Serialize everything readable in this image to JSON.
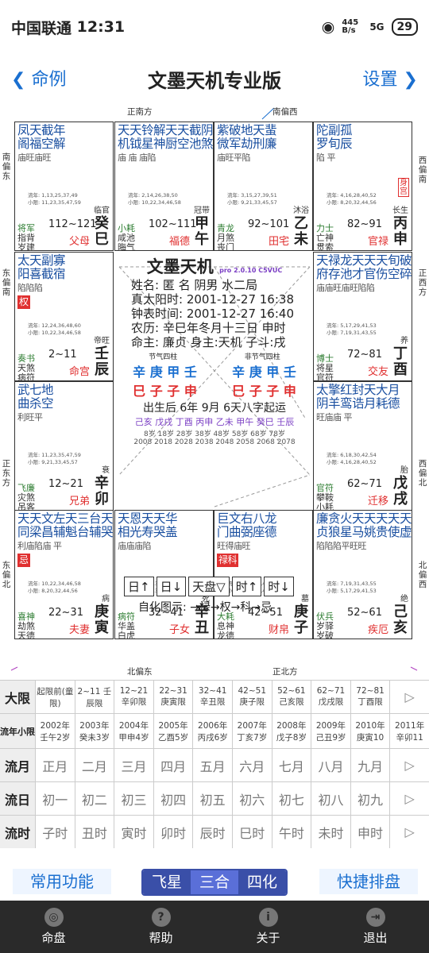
{
  "status": {
    "carrier": "中国联通",
    "time": "12:31",
    "net": "445 B/s",
    "sig": "5G",
    "battery": "29"
  },
  "nav": {
    "back": "命例",
    "title": "文墨天机专业版",
    "settings": "设置"
  },
  "dirs": {
    "top1": "正南方",
    "top2": "南偏西",
    "bot1": "北偏东",
    "bot2": "正北方",
    "l1": "南偏东",
    "l2": "东偏南",
    "l3": "正东方",
    "l4": "东偏北",
    "r1": "西偏南",
    "r2": "正西方",
    "r3": "西偏北",
    "r4": "北偏西"
  },
  "cells": [
    {
      "t1": "凤天截年",
      "t2": "阁福空解",
      "s": "庙旺庙旺",
      "ln1": "流年: 1,13,25,37,49",
      "ln2": "小限: 11,23,35,47,59",
      "rng": "112~121",
      "zs": "临官",
      "gz1": "癸",
      "gz2": "巳",
      "g1": "将军",
      "g2": "指背",
      "g3": "岁建",
      "pal": "父母"
    },
    {
      "t1": "天天铃解天天截阴",
      "t2": "机钺星神厨空池煞",
      "s": "庙 庙 庙陷",
      "ln1": "流年: 2,14,26,38,50",
      "ln2": "小限: 10,22,34,46,58",
      "rng": "102~111",
      "zs": "冠带",
      "gz1": "甲",
      "gz2": "午",
      "g1": "小耗",
      "g2": "咸池",
      "g3": "晦气",
      "pal": "福德"
    },
    {
      "t1": "紫破地天蜚",
      "t2": "微军劫刑廉",
      "s": "庙旺平陷",
      "ln1": "流年: 3,15,27,39,51",
      "ln2": "小限: 9,21,33,45,57",
      "rng": "92~101",
      "zs": "沐浴",
      "gz1": "乙",
      "gz2": "未",
      "g1": "青龙",
      "g2": "月煞",
      "g3": "丧门",
      "pal": "田宅"
    },
    {
      "t1": "陀副孤",
      "t2": "罗旬辰",
      "s": "陷 平",
      "ln1": "流年: 4,16,28,40,52",
      "ln2": "小限: 8,20,32,44,56",
      "rng": "82~91",
      "zs": "长生",
      "gz1": "丙",
      "gz2": "申",
      "g1": "力士",
      "g2": "亡神",
      "g3": "贯索",
      "pal": "官禄",
      "badge": "身宫"
    },
    {
      "t1": "太天副寡",
      "t2": "阳喜截宿",
      "s": "陷陷陷",
      "box": "权",
      "ln1": "流年: 12,24,36,48,60",
      "ln2": "小限: 10,22,34,46,58",
      "rng": "2~11",
      "zs": "帝旺",
      "gz1": "壬",
      "gz2": "辰",
      "g1": "奏书",
      "g2": "天煞",
      "g3": "病符",
      "pal": "命宫"
    },
    {
      "t1": "天禄龙天天天旬破",
      "t2": "府存池才官伤空碎",
      "s": "庙庙旺庙旺陷陷",
      "ln1": "流年: 5,17,29,41,53",
      "ln2": "小限: 7,19,31,43,55",
      "rng": "72~81",
      "zs": "养",
      "gz1": "丁",
      "gz2": "酉",
      "g1": "博士",
      "g2": "将星",
      "g3": "官符",
      "pal": "交友"
    },
    {
      "t1": "武七地",
      "t2": "曲杀空",
      "s": "利旺平",
      "ln1": "流年: 11,23,35,47,59",
      "ln2": "小限: 9,21,33,45,57",
      "rng": "12~21",
      "zs": "衰",
      "gz1": "辛",
      "gz2": "卯",
      "g1": "飞廉",
      "g2": "灾煞",
      "g3": "吊客",
      "pal": "兄弟"
    },
    {
      "t1": "太擎红封天大月",
      "t2": "阴羊鸾诰月耗德",
      "s": "旺庙庙 平",
      "ln1": "流年: 6,18,30,42,54",
      "ln2": "小限: 4,16,28,40,52",
      "rng": "62~71",
      "zs": "胎",
      "gz1": "戊",
      "gz2": "戌",
      "g1": "官符",
      "g2": "攀鞍",
      "g3": "小耗",
      "pal": "迁移"
    },
    {
      "t1": "天天文左天三台天劫天",
      "t2": "同梁昌辅魁台辅哭煞德",
      "s": "利庙陷庙 平",
      "box": "忌",
      "ln1": "流年: 10,22,34,46,58",
      "ln2": "小限: 8,20,32,44,56",
      "rng": "22~31",
      "zs": "病",
      "gz1": "庚",
      "gz2": "寅",
      "g1": "喜神",
      "g2": "劫煞",
      "g3": "天德",
      "pal": "夫妻"
    },
    {
      "t1": "天恩天天华",
      "t2": "相光寿哭盖",
      "s": "庙庙庙陷",
      "ln1": "流年: 9,21,33,45,57",
      "ln2": "小限: 7,19,31,43,55",
      "rng": "32~41",
      "zs": "死",
      "gz1": "辛",
      "gz2": "丑",
      "g1": "病符",
      "g2": "华盖",
      "g3": "白虎",
      "pal": "子女"
    },
    {
      "t1": "巨文右八龙",
      "t2": "门曲弼座德",
      "s": "旺得庙旺",
      "box": "禄科",
      "ln1": "流年: 8,20,32,44,56",
      "ln2": "小限: 6,18,30,42,54",
      "rng": "42~51",
      "zs": "墓",
      "gz1": "庚",
      "gz2": "子",
      "g1": "大耗",
      "g2": "息神",
      "g3": "龙德",
      "pal": "财帛"
    },
    {
      "t1": "廉贪火天天天天天",
      "t2": "贞狼星马姚贵使虚",
      "s": "陷陷陷平旺旺",
      "ln1": "流年: 7,19,31,43,55",
      "ln2": "小限: 5,17,29,41,53",
      "rng": "52~61",
      "zs": "绝",
      "gz1": "己",
      "gz2": "亥",
      "g1": "伏兵",
      "g2": "岁驿",
      "g3": "岁破",
      "pal": "疾厄"
    }
  ],
  "center": {
    "title": "文墨天机",
    "ver": "pro 2.0.10 C5VUC",
    "l1": "姓名: 匿 名     阴男 水二局",
    "l2": "真太阳时: 2001-12-27 16:38",
    "l3": "钟表时间: 2001-12-27 16:40",
    "l4": "农历: 辛巳年冬月十三日 申时",
    "l5": "命主: 廉贞 身主:天机 子斗:戌",
    "jq": "节气四柱",
    "fjq": "非节气四柱",
    "bz1": "辛 庚 甲 壬",
    "bz2": "巳 子 子 申",
    "bz3": "辛 庚 甲 壬",
    "bz4": "巳 子 子 申",
    "qy": "出生后 6年 9月 6天八字起运",
    "dy": "己亥 戊戌 丁酉 丙申 乙未 甲午 癸巳 壬辰",
    "dya": "8岁 18岁 28岁 38岁 48岁 58岁 68岁 78岁",
    "dyy": "2008 2018 2028 2038 2048 2058 2068 2078"
  },
  "ctrl": [
    "日↑",
    "日↓",
    "天盘▽",
    "时↑",
    "时↓"
  ],
  "sihua": "自化图示: →禄→权→科→忌",
  "dx": {
    "label": "大限",
    "cols": [
      "起限前(童限)",
      "2~11 壬辰限",
      "12~21 辛卯限",
      "22~31 庚寅限",
      "32~41 辛丑限",
      "42~51 庚子限",
      "52~61 己亥限",
      "62~71 戊戌限",
      "72~81 丁酉限"
    ]
  },
  "ln": {
    "label": "流年小限",
    "cols": [
      "2002年 壬午2岁",
      "2003年 癸未3岁",
      "2004年 甲申4岁",
      "2005年 乙酉5岁",
      "2006年 丙戌6岁",
      "2007年 丁亥7岁",
      "2008年 戊子8岁",
      "2009年 己丑9岁",
      "2010年 庚寅10",
      "2011年 辛卯11"
    ]
  },
  "ly": {
    "label": "流月",
    "cols": [
      "正月",
      "二月",
      "三月",
      "四月",
      "五月",
      "六月",
      "七月",
      "八月",
      "九月"
    ]
  },
  "lr": {
    "label": "流日",
    "cols": [
      "初一",
      "初二",
      "初三",
      "初四",
      "初五",
      "初六",
      "初七",
      "初八",
      "初九"
    ]
  },
  "ls": {
    "label": "流时",
    "cols": [
      "子时",
      "丑时",
      "寅时",
      "卯时",
      "辰时",
      "巳时",
      "午时",
      "未时",
      "申时"
    ]
  },
  "btn": {
    "common": "常用功能",
    "fx": "飞星",
    "sh": "三合",
    "sihua": "四化",
    "quick": "快捷排盘"
  },
  "tabs": [
    "命盘",
    "帮助",
    "关于",
    "退出"
  ]
}
